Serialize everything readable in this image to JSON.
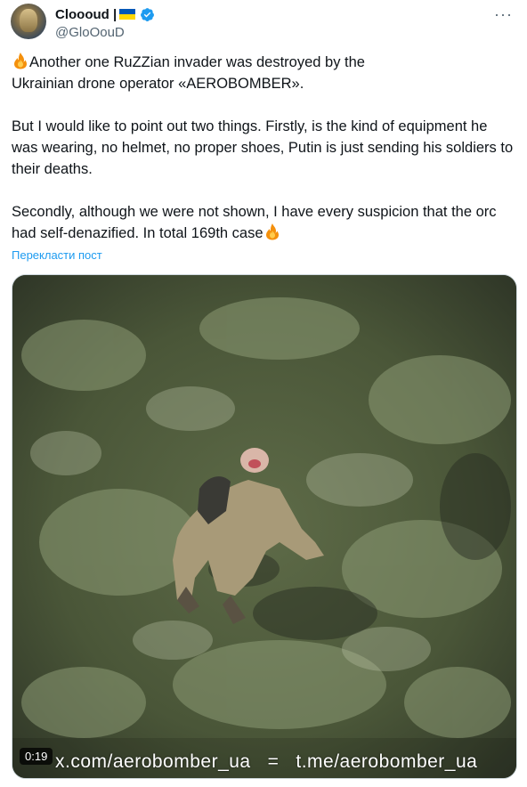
{
  "author": {
    "display_name": "Cloooud |",
    "handle": "@GloOouD",
    "flag_icon": "ukraine-flag-icon",
    "verified_icon": "verified-badge-icon",
    "verified_color": "#1d9bf0"
  },
  "more_label": "···",
  "tweet": {
    "line1_a": "Another one RuZZian invader was destroyed by the ",
    "line1_b": "Ukrainian drone operator «AEROBOMBER».",
    "para2": "But I would like to point out two things. Firstly, is the kind of equipment he was wearing, no helmet, no proper shoes, Putin is just sending his soldiers to their deaths.",
    "para3": "Secondly, although we were not shown, I have every suspicion that the orc had self-denazified. In total 169th case"
  },
  "translate_label": "Перекласти пост",
  "media": {
    "duration": "0:19",
    "watermark": "x.com/aerobomber_ua   =   t.me/aerobomber_ua"
  },
  "colors": {
    "text": "#0f1419",
    "secondary": "#536471",
    "link": "#1d9bf0",
    "flag_blue": "#0057b7",
    "flag_yellow": "#ffd700"
  }
}
